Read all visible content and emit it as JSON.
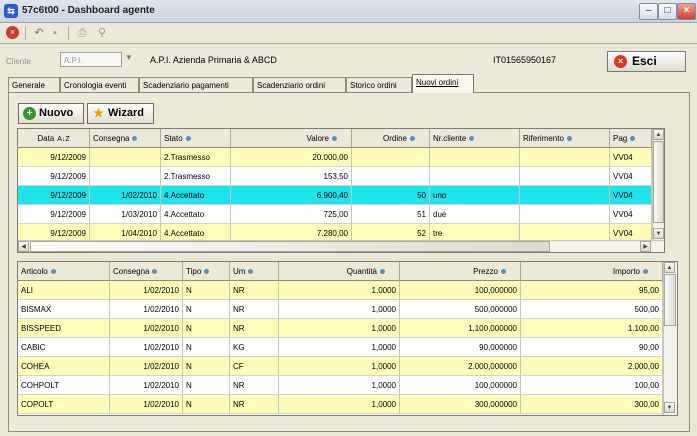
{
  "window": {
    "title": "57c6t00 - Dashboard agente"
  },
  "header": {
    "cliente_label": "Cliente",
    "cliente_code": "A.P.I.",
    "cliente_name": "A.P.I. Azienda Primaria & ABCD",
    "partita_iva": "IT01565950167",
    "esci_label": "Esci"
  },
  "tabs": [
    {
      "label": "Generale",
      "active": false
    },
    {
      "label": "Cronologia eventi",
      "active": false
    },
    {
      "label": "Scadenziario pagamenti",
      "active": false
    },
    {
      "label": "Scadenziario ordini",
      "active": false
    },
    {
      "label": "Storico ordini",
      "active": false
    },
    {
      "label": "Nuovi ordini",
      "active": true
    }
  ],
  "actions": {
    "nuovo_label": "Nuovo",
    "wizard_label": "Wizard"
  },
  "orders_grid": {
    "columns": [
      "Data",
      "Consegna",
      "Stato",
      "Valore",
      "Ordine",
      "Nr.cliente",
      "Riferimento",
      "Pag"
    ],
    "rows": [
      {
        "data": "9/12/2009",
        "consegna": "",
        "stato": "2.Trasmesso",
        "valore": "20.000,00",
        "ordine": "",
        "nr_cliente": "",
        "riferimento": "",
        "pag": "VV04",
        "color": "yellow"
      },
      {
        "data": "9/12/2009",
        "consegna": "",
        "stato": "2.Trasmesso",
        "valore": "153,50",
        "ordine": "",
        "nr_cliente": "",
        "riferimento": "",
        "pag": "VV04",
        "color": "white"
      },
      {
        "data": "9/12/2009",
        "consegna": "1/02/2010",
        "stato": "4.Accettato",
        "valore": "6.900,40",
        "ordine": "50",
        "nr_cliente": "uno",
        "riferimento": "",
        "pag": "VV04",
        "color": "cyan"
      },
      {
        "data": "9/12/2009",
        "consegna": "1/03/2010",
        "stato": "4.Accettato",
        "valore": "725,00",
        "ordine": "51",
        "nr_cliente": "due",
        "riferimento": "",
        "pag": "VV04",
        "color": "white"
      },
      {
        "data": "9/12/2009",
        "consegna": "1/04/2010",
        "stato": "4.Accettato",
        "valore": "7.280,00",
        "ordine": "52",
        "nr_cliente": "tre",
        "riferimento": "",
        "pag": "VV04",
        "color": "yellow"
      }
    ]
  },
  "lines_grid": {
    "columns": [
      "Articolo",
      "Consegna",
      "Tipo",
      "Um",
      "Quantità",
      "Prezzo",
      "Importo"
    ],
    "rows": [
      {
        "articolo": "ALI",
        "consegna": "1/02/2010",
        "tipo": "N",
        "um": "NR",
        "quantita": "1,0000",
        "prezzo": "100,000000",
        "importo": "95,00",
        "color": "yellow"
      },
      {
        "articolo": "BISMAX",
        "consegna": "1/02/2010",
        "tipo": "N",
        "um": "NR",
        "quantita": "1,0000",
        "prezzo": "500,000000",
        "importo": "500,00",
        "color": "white"
      },
      {
        "articolo": "BISSPEED",
        "consegna": "1/02/2010",
        "tipo": "N",
        "um": "NR",
        "quantita": "1,0000",
        "prezzo": "1.100,000000",
        "importo": "1.100,00",
        "color": "yellow"
      },
      {
        "articolo": "CABIC",
        "consegna": "1/02/2010",
        "tipo": "N",
        "um": "KG",
        "quantita": "1,0000",
        "prezzo": "90,000000",
        "importo": "90,00",
        "color": "white"
      },
      {
        "articolo": "COHEA",
        "consegna": "1/02/2010",
        "tipo": "N",
        "um": "CF",
        "quantita": "1,0000",
        "prezzo": "2.000,000000",
        "importo": "2.000,00",
        "color": "yellow"
      },
      {
        "articolo": "COHPOLT",
        "consegna": "1/02/2010",
        "tipo": "N",
        "um": "NR",
        "quantita": "1,0000",
        "prezzo": "100,000000",
        "importo": "100,00",
        "color": "white"
      },
      {
        "articolo": "COPOLT",
        "consegna": "1/02/2010",
        "tipo": "N",
        "um": "NR",
        "quantita": "1,0000",
        "prezzo": "300,000000",
        "importo": "300,00",
        "color": "yellow"
      }
    ]
  }
}
